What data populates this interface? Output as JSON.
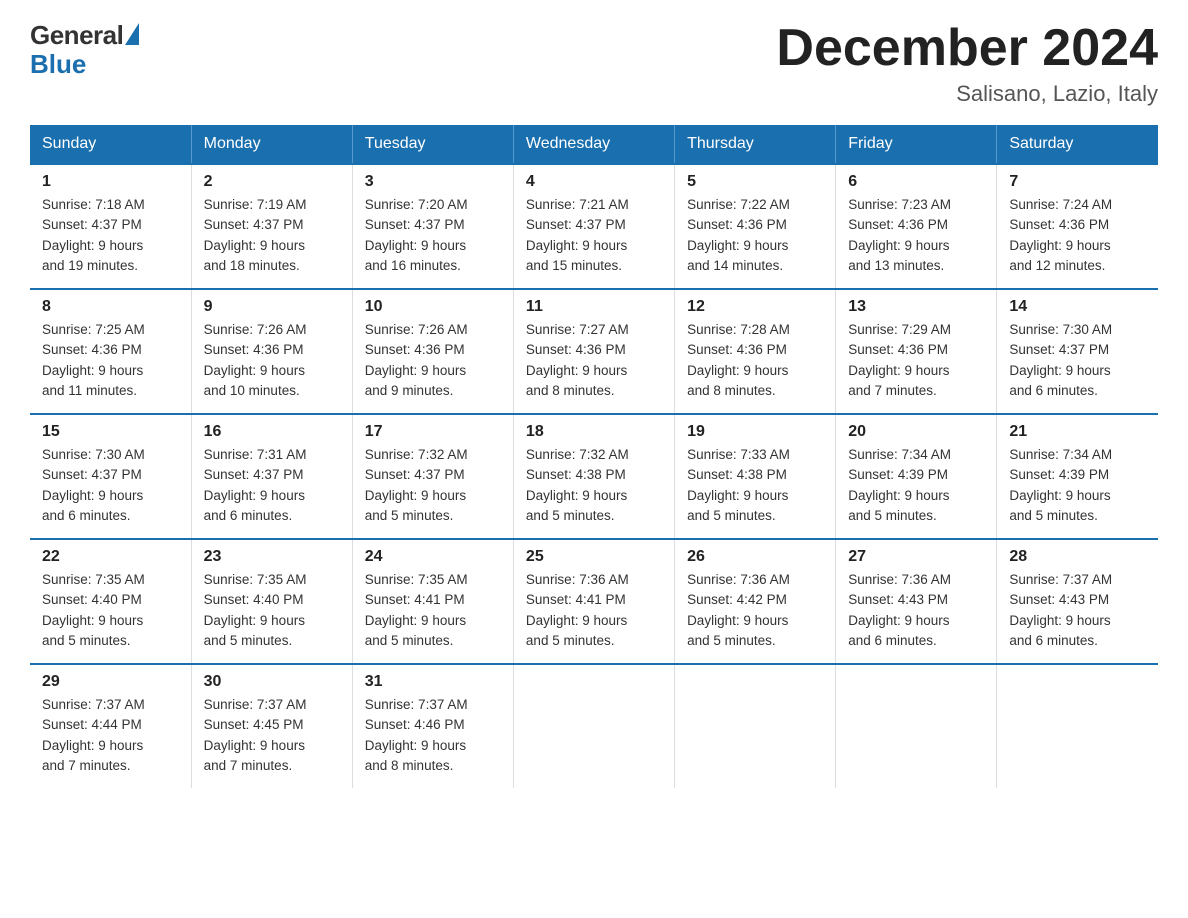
{
  "logo": {
    "general": "General",
    "blue": "Blue"
  },
  "title": "December 2024",
  "subtitle": "Salisano, Lazio, Italy",
  "days_header": [
    "Sunday",
    "Monday",
    "Tuesday",
    "Wednesday",
    "Thursday",
    "Friday",
    "Saturday"
  ],
  "weeks": [
    [
      {
        "day": "1",
        "sunrise": "7:18 AM",
        "sunset": "4:37 PM",
        "daylight": "9 hours and 19 minutes."
      },
      {
        "day": "2",
        "sunrise": "7:19 AM",
        "sunset": "4:37 PM",
        "daylight": "9 hours and 18 minutes."
      },
      {
        "day": "3",
        "sunrise": "7:20 AM",
        "sunset": "4:37 PM",
        "daylight": "9 hours and 16 minutes."
      },
      {
        "day": "4",
        "sunrise": "7:21 AM",
        "sunset": "4:37 PM",
        "daylight": "9 hours and 15 minutes."
      },
      {
        "day": "5",
        "sunrise": "7:22 AM",
        "sunset": "4:36 PM",
        "daylight": "9 hours and 14 minutes."
      },
      {
        "day": "6",
        "sunrise": "7:23 AM",
        "sunset": "4:36 PM",
        "daylight": "9 hours and 13 minutes."
      },
      {
        "day": "7",
        "sunrise": "7:24 AM",
        "sunset": "4:36 PM",
        "daylight": "9 hours and 12 minutes."
      }
    ],
    [
      {
        "day": "8",
        "sunrise": "7:25 AM",
        "sunset": "4:36 PM",
        "daylight": "9 hours and 11 minutes."
      },
      {
        "day": "9",
        "sunrise": "7:26 AM",
        "sunset": "4:36 PM",
        "daylight": "9 hours and 10 minutes."
      },
      {
        "day": "10",
        "sunrise": "7:26 AM",
        "sunset": "4:36 PM",
        "daylight": "9 hours and 9 minutes."
      },
      {
        "day": "11",
        "sunrise": "7:27 AM",
        "sunset": "4:36 PM",
        "daylight": "9 hours and 8 minutes."
      },
      {
        "day": "12",
        "sunrise": "7:28 AM",
        "sunset": "4:36 PM",
        "daylight": "9 hours and 8 minutes."
      },
      {
        "day": "13",
        "sunrise": "7:29 AM",
        "sunset": "4:36 PM",
        "daylight": "9 hours and 7 minutes."
      },
      {
        "day": "14",
        "sunrise": "7:30 AM",
        "sunset": "4:37 PM",
        "daylight": "9 hours and 6 minutes."
      }
    ],
    [
      {
        "day": "15",
        "sunrise": "7:30 AM",
        "sunset": "4:37 PM",
        "daylight": "9 hours and 6 minutes."
      },
      {
        "day": "16",
        "sunrise": "7:31 AM",
        "sunset": "4:37 PM",
        "daylight": "9 hours and 6 minutes."
      },
      {
        "day": "17",
        "sunrise": "7:32 AM",
        "sunset": "4:37 PM",
        "daylight": "9 hours and 5 minutes."
      },
      {
        "day": "18",
        "sunrise": "7:32 AM",
        "sunset": "4:38 PM",
        "daylight": "9 hours and 5 minutes."
      },
      {
        "day": "19",
        "sunrise": "7:33 AM",
        "sunset": "4:38 PM",
        "daylight": "9 hours and 5 minutes."
      },
      {
        "day": "20",
        "sunrise": "7:34 AM",
        "sunset": "4:39 PM",
        "daylight": "9 hours and 5 minutes."
      },
      {
        "day": "21",
        "sunrise": "7:34 AM",
        "sunset": "4:39 PM",
        "daylight": "9 hours and 5 minutes."
      }
    ],
    [
      {
        "day": "22",
        "sunrise": "7:35 AM",
        "sunset": "4:40 PM",
        "daylight": "9 hours and 5 minutes."
      },
      {
        "day": "23",
        "sunrise": "7:35 AM",
        "sunset": "4:40 PM",
        "daylight": "9 hours and 5 minutes."
      },
      {
        "day": "24",
        "sunrise": "7:35 AM",
        "sunset": "4:41 PM",
        "daylight": "9 hours and 5 minutes."
      },
      {
        "day": "25",
        "sunrise": "7:36 AM",
        "sunset": "4:41 PM",
        "daylight": "9 hours and 5 minutes."
      },
      {
        "day": "26",
        "sunrise": "7:36 AM",
        "sunset": "4:42 PM",
        "daylight": "9 hours and 5 minutes."
      },
      {
        "day": "27",
        "sunrise": "7:36 AM",
        "sunset": "4:43 PM",
        "daylight": "9 hours and 6 minutes."
      },
      {
        "day": "28",
        "sunrise": "7:37 AM",
        "sunset": "4:43 PM",
        "daylight": "9 hours and 6 minutes."
      }
    ],
    [
      {
        "day": "29",
        "sunrise": "7:37 AM",
        "sunset": "4:44 PM",
        "daylight": "9 hours and 7 minutes."
      },
      {
        "day": "30",
        "sunrise": "7:37 AM",
        "sunset": "4:45 PM",
        "daylight": "9 hours and 7 minutes."
      },
      {
        "day": "31",
        "sunrise": "7:37 AM",
        "sunset": "4:46 PM",
        "daylight": "9 hours and 8 minutes."
      },
      null,
      null,
      null,
      null
    ]
  ],
  "labels": {
    "sunrise": "Sunrise: ",
    "sunset": "Sunset: ",
    "daylight": "Daylight: "
  }
}
